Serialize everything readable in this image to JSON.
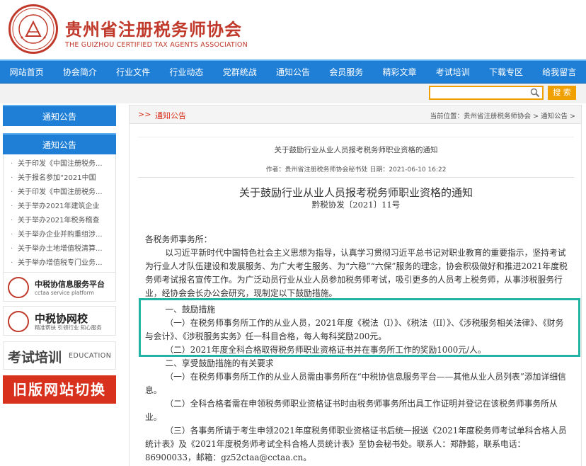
{
  "header": {
    "title": "贵州省注册税务师协会",
    "subtitle": "THE GUIZHOU CERTIFIED TAX AGENTS ASSOCIATION"
  },
  "nav": {
    "items": [
      "网站首页",
      "协会简介",
      "行业文件",
      "行业动态",
      "党群统战",
      "通知公告",
      "会员服务",
      "精彩文章",
      "考试培训",
      "下载专区",
      "给我留言"
    ]
  },
  "search": {
    "placeholder": "",
    "button_label": "搜 索"
  },
  "sidebar": {
    "tab1": "通知公告",
    "tab2": "通知公告",
    "items": [
      "关于印发《中国注册税务...",
      "关于报名参加“2021中国",
      "关于印发《中国注册税务...",
      "关于举办2021年建筑企业",
      "关于举办2021年税务稽查",
      "关于举办企业并购重组涉...",
      "关于举办土地增值税清算...",
      "关于举办增值税专门业务..."
    ],
    "banner1": {
      "title": "中税协信息服务平台",
      "sub": "cctaa service platform"
    },
    "banner2": {
      "title": "中税协网校",
      "sub": "精准帮扶 引领行业 知心服务"
    },
    "edu": {
      "big": "考试培训",
      "small": "EDUCATION"
    },
    "old": "旧版网站切换"
  },
  "main": {
    "crumb_title": "通知公告",
    "crumb_path": "当前位置：贵州省注册税务师协会 > 通知公告 >",
    "head_title": "关于鼓励行业从业人员报考税务师职业资格的通知",
    "meta": "作者：贵州省注册税务师协会秘书处 日期：2021-06-10 16:22",
    "title": "关于鼓励行业从业人员报考税务师职业资格的通知",
    "docno": "黔税协发〔2021〕11号",
    "greeting": "各税务师事务所：",
    "p1": "以习近平新时代中国特色社会主义思想为指导，认真学习贯彻习近平总书记对职业教育的重要指示，坚持考试为行业人才队伍建设和发展服务、为广大考生服务、为“六稳”“六保”服务的理念，协会积极做好和推进2021年度税务师考试报名宣传工作。为广泛动员行业从业人员参加税务师考试，吸引更多的人员考上税务师，从事涉税服务行业，经协会会长办公会研究，现制定以下鼓励措施。",
    "s1": "一、鼓励措施",
    "s1p1": "（一）在税务师事务所工作的从业人员，2021年度《税法（I）》、《税法（II）》、《涉税服务相关法律》、《财务与会计》、《涉税服务实务》任一科目合格，每人每科奖励200元。",
    "s1p2": "（二）2021年度全科合格取得税务师职业资格证书并在事务所工作的奖励1000元/人。",
    "s2": "二、享受鼓励措施的有关要求",
    "s2p1": "（一）在税务师事务所工作的从业人员需由事务所在“中税协信息服务平台——其他从业人员列表”添加详细信息。",
    "s2p2": "（二）全科合格者需在申领税务师职业资格证书时由税务师事务所出具工作证明并登记在该税务师事务所从业。",
    "s2p3": "（三）各事务所请于考生申领2021年度税务师职业资格证书后统一报送《2021年度税务师考试单科合格人员统计表》及《2021年度税务师考试全科合格人员统计表》至协会秘书处。联系人：郑静懿，联系电话：86900033，邮箱：gz52ctaa@cctaa.cn。"
  },
  "colors": {
    "nav_blue": "#1f7fd6",
    "brand_red": "#c0392b",
    "search_orange": "#f0a000",
    "highlight_teal": "#21b4a6"
  }
}
